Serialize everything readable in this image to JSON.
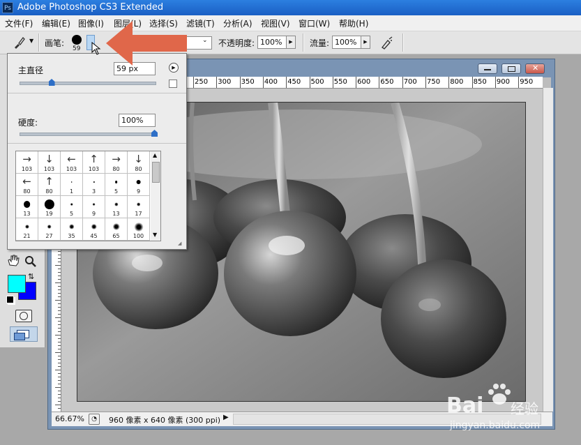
{
  "window": {
    "title": "Adobe Photoshop CS3 Extended",
    "logo_text": "Ps"
  },
  "menu": [
    "文件(F)",
    "编辑(E)",
    "图像(I)",
    "图层(L)",
    "选择(S)",
    "滤镜(T)",
    "分析(A)",
    "视图(V)",
    "窗口(W)",
    "帮助(H)"
  ],
  "options": {
    "brush_label": "画笔:",
    "brush_size": "59",
    "opacity_label": "不透明度:",
    "opacity_value": "100%",
    "flow_label": "流量:",
    "flow_value": "100%"
  },
  "brush_popup": {
    "master_diameter_label": "主直径",
    "master_diameter_value": "59 px",
    "master_diameter_fraction": 0.24,
    "hardness_label": "硬度:",
    "hardness_value": "100%",
    "hardness_fraction": 1.0,
    "presets": [
      {
        "kind": "arrow",
        "glyph": "→",
        "size": "103"
      },
      {
        "kind": "arrow",
        "glyph": "↓",
        "size": "103"
      },
      {
        "kind": "arrow",
        "glyph": "←",
        "size": "103"
      },
      {
        "kind": "arrow",
        "glyph": "↑",
        "size": "103"
      },
      {
        "kind": "arrow",
        "glyph": "→",
        "size": "80"
      },
      {
        "kind": "arrow",
        "glyph": "↓",
        "size": "80"
      },
      {
        "kind": "arrow",
        "glyph": "←",
        "size": "80"
      },
      {
        "kind": "arrow",
        "glyph": "↑",
        "size": "80"
      },
      {
        "kind": "hard",
        "size": "1"
      },
      {
        "kind": "hard",
        "size": "3"
      },
      {
        "kind": "hard",
        "size": "5"
      },
      {
        "kind": "hard",
        "size": "9"
      },
      {
        "kind": "hard",
        "size": "13"
      },
      {
        "kind": "hard",
        "size": "19"
      },
      {
        "kind": "soft",
        "size": "5"
      },
      {
        "kind": "soft",
        "size": "9"
      },
      {
        "kind": "soft",
        "size": "13"
      },
      {
        "kind": "soft",
        "size": "17"
      },
      {
        "kind": "soft",
        "size": "21"
      },
      {
        "kind": "soft",
        "size": "27"
      },
      {
        "kind": "soft",
        "size": "35"
      },
      {
        "kind": "soft",
        "size": "45"
      },
      {
        "kind": "soft",
        "size": "65"
      },
      {
        "kind": "soft",
        "size": "100"
      }
    ]
  },
  "ruler": {
    "ticks": [
      "250",
      "300",
      "350",
      "400",
      "450",
      "500",
      "550",
      "600",
      "650",
      "700",
      "750",
      "800",
      "850",
      "900",
      "950"
    ]
  },
  "status": {
    "zoom": "66.67%",
    "doc_info": "960 像素 x 640 像素 (300 ppi)"
  },
  "colors": {
    "foreground": "#00ffff",
    "background": "#0000ff",
    "annotation_arrow": "#e0674a"
  },
  "icons": {
    "brush_tool": "brush-icon",
    "airbrush": "airbrush-icon",
    "hand": "hand-icon",
    "zoom": "zoom-icon",
    "quick_mask": "quick-mask-icon",
    "screen_mode": "screen-mode-icon"
  },
  "watermark": {
    "brand": "Bai",
    "brand2": "经验",
    "domain": "jingyan.baidu.com"
  }
}
